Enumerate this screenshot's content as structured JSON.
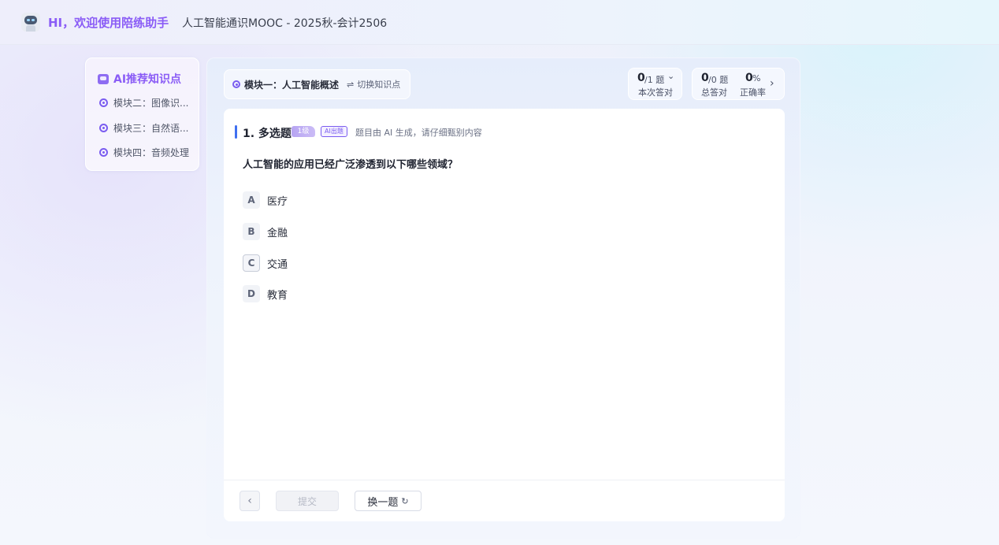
{
  "header": {
    "greeting": "HI，欢迎使用陪练助手",
    "course": "人工智能通识MOOC  -  2025秋-会计2506"
  },
  "sidebar": {
    "title": "AI推荐知识点",
    "items": [
      {
        "label": "模块二：图像识..."
      },
      {
        "label": "模块三：自然语..."
      },
      {
        "label": "模块四：音频处理"
      }
    ]
  },
  "module": {
    "current": "模块一：人工智能概述",
    "switch_glyph": "⇌",
    "switch_label": "切换知识点"
  },
  "stats": {
    "session": {
      "num": "0",
      "unit": "/1 题",
      "label": "本次答对",
      "chevron": "⌄"
    },
    "total": {
      "num": "0",
      "unit": "/0 题",
      "label": "总答对"
    },
    "accuracy": {
      "num": "0",
      "unit": "%",
      "label": "正确率",
      "chevron": "›"
    }
  },
  "question": {
    "title": "1. 多选题",
    "level": "1级",
    "ai_badge": "AI出题",
    "ai_note": "题目由 AI 生成，请仔细甄别内容",
    "text": "人工智能的应用已经广泛渗透到以下哪些领域？",
    "options": [
      {
        "key": "A",
        "text": "医疗"
      },
      {
        "key": "B",
        "text": "金融"
      },
      {
        "key": "C",
        "text": "交通"
      },
      {
        "key": "D",
        "text": "教育"
      }
    ]
  },
  "footer": {
    "back_glyph": "‹",
    "submit_label": "提交",
    "swap_label": "换一题",
    "swap_glyph": "↻"
  }
}
